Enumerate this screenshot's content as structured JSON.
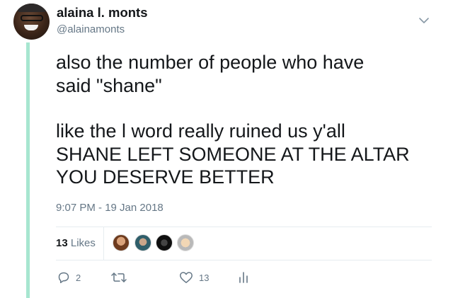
{
  "tweet": {
    "author": {
      "display_name": "alaina l. monts",
      "handle": "@alainamonts"
    },
    "text_lines": [
      "also the number of people who have",
      "said \"shane\"",
      "like the l word really ruined us y'all",
      "SHANE LEFT SOMEONE AT THE ALTAR",
      "YOU DESERVE BETTER"
    ],
    "timestamp": "9:07 PM - 19 Jan 2018",
    "stats": {
      "likes_count": "13",
      "likes_label": "Likes"
    },
    "actions": {
      "reply_count": "2",
      "like_count": "13"
    }
  },
  "colors": {
    "thread_line": "#a7e6d0",
    "secondary_text": "#657786",
    "primary_text": "#14171a"
  },
  "icons": [
    "chevron-down-icon",
    "reply-icon",
    "retweet-icon",
    "heart-icon",
    "analytics-icon"
  ]
}
